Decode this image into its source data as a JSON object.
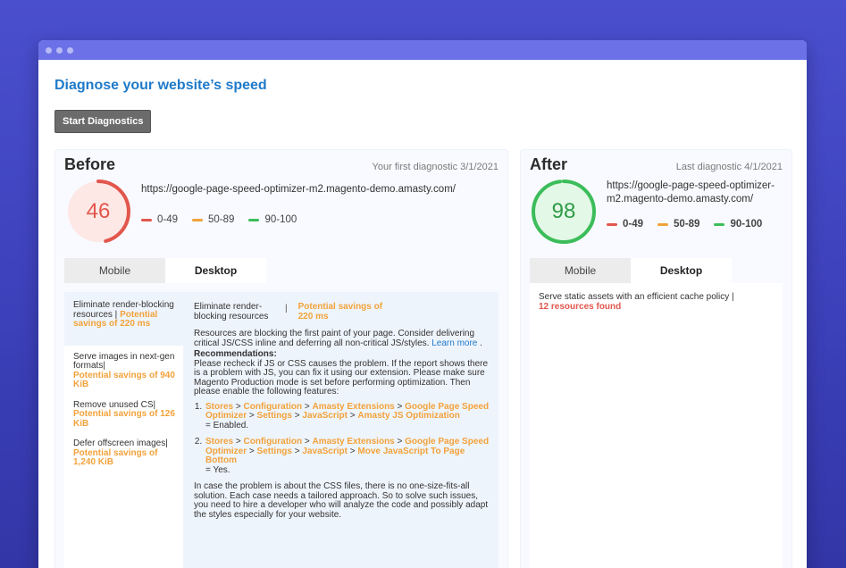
{
  "heading": "Diagnose your website’s speed",
  "start_button": "Start Diagnostics",
  "colors": {
    "red": "#e2564c",
    "orange": "#f2a23a",
    "green": "#3cbd5a",
    "accent": "#1f7ac9"
  },
  "legend": [
    "0-49",
    "50-89",
    "90-100"
  ],
  "before": {
    "title": "Before",
    "date": "Your first diagnostic 3/1/2021",
    "score": "46",
    "score_fraction": 0.46,
    "url": "https://google-page-speed-optimizer-m2.magento-demo.amasty.com/",
    "tabs": [
      "Mobile",
      "Desktop"
    ],
    "issues": [
      {
        "text": "Eliminate render-blocking resources | ",
        "savings": "Potential savings of 220 ms"
      },
      {
        "text": "Serve images in next-gen formats|",
        "savings": "Potential savings of 940 KiB"
      },
      {
        "text": "Remove unused CS|",
        "savings": "Potential savings of 126 KiB"
      },
      {
        "text": "Defer offscreen images|",
        "savings": "Potential savings of 1,240 KiB"
      }
    ],
    "detail": {
      "title": "Eliminate render-blocking resources",
      "savings": "Potential savings of 220 ms",
      "desc": "Resources are blocking the first paint of your page. Consider delivering critical JS/CSS inline and deferring all non-critical JS/styles.",
      "learn_more": "Learn more",
      "rec_title": "Recommendations:",
      "rec_text": "Please recheck if JS or CSS causes the problem. If the report shows there is a problem with JS, you can fix it using our extension. Please make sure Magento Production mode is set before performing optimization. Then please enable the following features:",
      "steps": [
        {
          "path": [
            "Stores",
            "Configuration",
            "Amasty Extensions",
            "Google Page Speed Optimizer",
            "Settings",
            "JavaScript",
            "Amasty JS Optimization"
          ],
          "value": "= Enabled."
        },
        {
          "path": [
            "Stores",
            "Configuration",
            "Amasty Extensions",
            "Google Page Speed Optimizer",
            "Settings",
            "JavaScript",
            "Move JavaScript To Page Bottom"
          ],
          "value": "= Yes."
        }
      ],
      "css_note": "In case the problem is about the CSS files, there is no one-size-fits-all solution. Each case needs a tailored approach. So to solve such issues, you need to hire a developer who will analyze the code and possibly adapt the styles especially for your website."
    }
  },
  "after": {
    "title": "After",
    "date": "Last diagnostic 4/1/2021",
    "score": "98",
    "score_fraction": 0.98,
    "url": "https://google-page-speed-optimizer-m2.magento-demo.amasty.com/",
    "tabs": [
      "Mobile",
      "Desktop"
    ],
    "issue_text": "Serve static assets with an efficient cache policy |",
    "issue_count": "12 resources found"
  }
}
